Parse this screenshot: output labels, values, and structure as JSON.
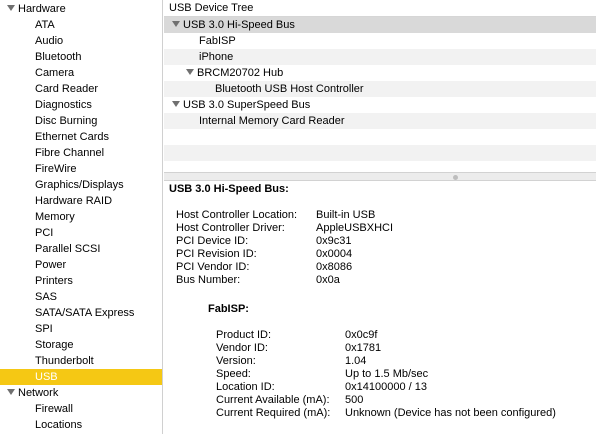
{
  "sidebar": {
    "groups": [
      {
        "label": "Hardware",
        "items": [
          "ATA",
          "Audio",
          "Bluetooth",
          "Camera",
          "Card Reader",
          "Diagnostics",
          "Disc Burning",
          "Ethernet Cards",
          "Fibre Channel",
          "FireWire",
          "Graphics/Displays",
          "Hardware RAID",
          "Memory",
          "PCI",
          "Parallel SCSI",
          "Power",
          "Printers",
          "SAS",
          "SATA/SATA Express",
          "SPI",
          "Storage",
          "Thunderbolt",
          "USB"
        ]
      },
      {
        "label": "Network",
        "items": [
          "Firewall",
          "Locations"
        ]
      }
    ],
    "selected": "USB",
    "accent": "#f5c814"
  },
  "tree": {
    "header": "USB Device Tree",
    "rows": [
      {
        "label": "USB 3.0 Hi-Speed Bus"
      },
      {
        "label": "FabISP"
      },
      {
        "label": "iPhone"
      },
      {
        "label": "BRCM20702 Hub"
      },
      {
        "label": "Bluetooth USB Host Controller"
      },
      {
        "label": "USB 3.0 SuperSpeed Bus"
      },
      {
        "label": "Internal Memory Card Reader"
      }
    ]
  },
  "detail": {
    "title": "USB 3.0 Hi-Speed Bus:",
    "bus_props": [
      {
        "key": "Host Controller Location:",
        "value": "Built-in USB"
      },
      {
        "key": "Host Controller Driver:",
        "value": "AppleUSBXHCI"
      },
      {
        "key": "PCI Device ID:",
        "value": "0x9c31"
      },
      {
        "key": "PCI Revision ID:",
        "value": "0x0004"
      },
      {
        "key": "PCI Vendor ID:",
        "value": "0x8086"
      },
      {
        "key": "Bus Number:",
        "value": "0x0a"
      }
    ],
    "device_title": "FabISP:",
    "device_props": [
      {
        "key": "Product ID:",
        "value": "0x0c9f"
      },
      {
        "key": "Vendor ID:",
        "value": "0x1781"
      },
      {
        "key": "Version:",
        "value": "1.04"
      },
      {
        "key": "Speed:",
        "value": "Up to 1.5 Mb/sec"
      },
      {
        "key": "Location ID:",
        "value": "0x14100000 / 13"
      },
      {
        "key": "Current Available (mA):",
        "value": "500"
      },
      {
        "key": "Current Required (mA):",
        "value": "Unknown (Device has not been configured)"
      }
    ]
  }
}
